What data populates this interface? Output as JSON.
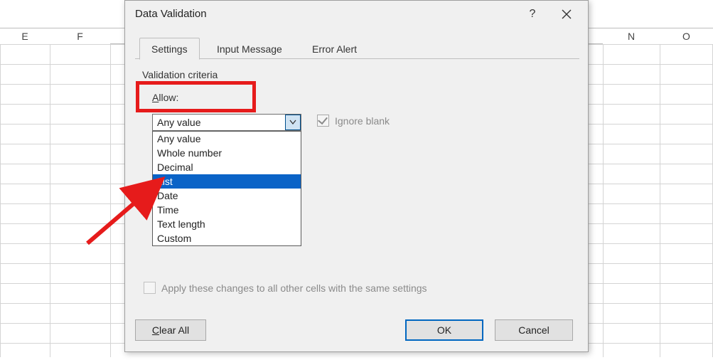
{
  "sheet": {
    "columns": {
      "E": "E",
      "F": "F",
      "N": "N",
      "O": "O"
    }
  },
  "dialog": {
    "title": "Data Validation",
    "tabs": [
      "Settings",
      "Input Message",
      "Error Alert"
    ],
    "section_label": "Validation criteria",
    "allow_label_u": "A",
    "allow_label_rest": "llow:",
    "combo_value": "Any value",
    "dropdown_options": [
      "Any value",
      "Whole number",
      "Decimal",
      "List",
      "Date",
      "Time",
      "Text length",
      "Custom"
    ],
    "dropdown_selected_index": 3,
    "ignore_blank_label": "Ignore blank",
    "apply_label": "Apply these changes to all other cells with the same settings",
    "buttons": {
      "clear_u": "C",
      "clear_rest": "lear All",
      "ok": "OK",
      "cancel": "Cancel"
    }
  }
}
